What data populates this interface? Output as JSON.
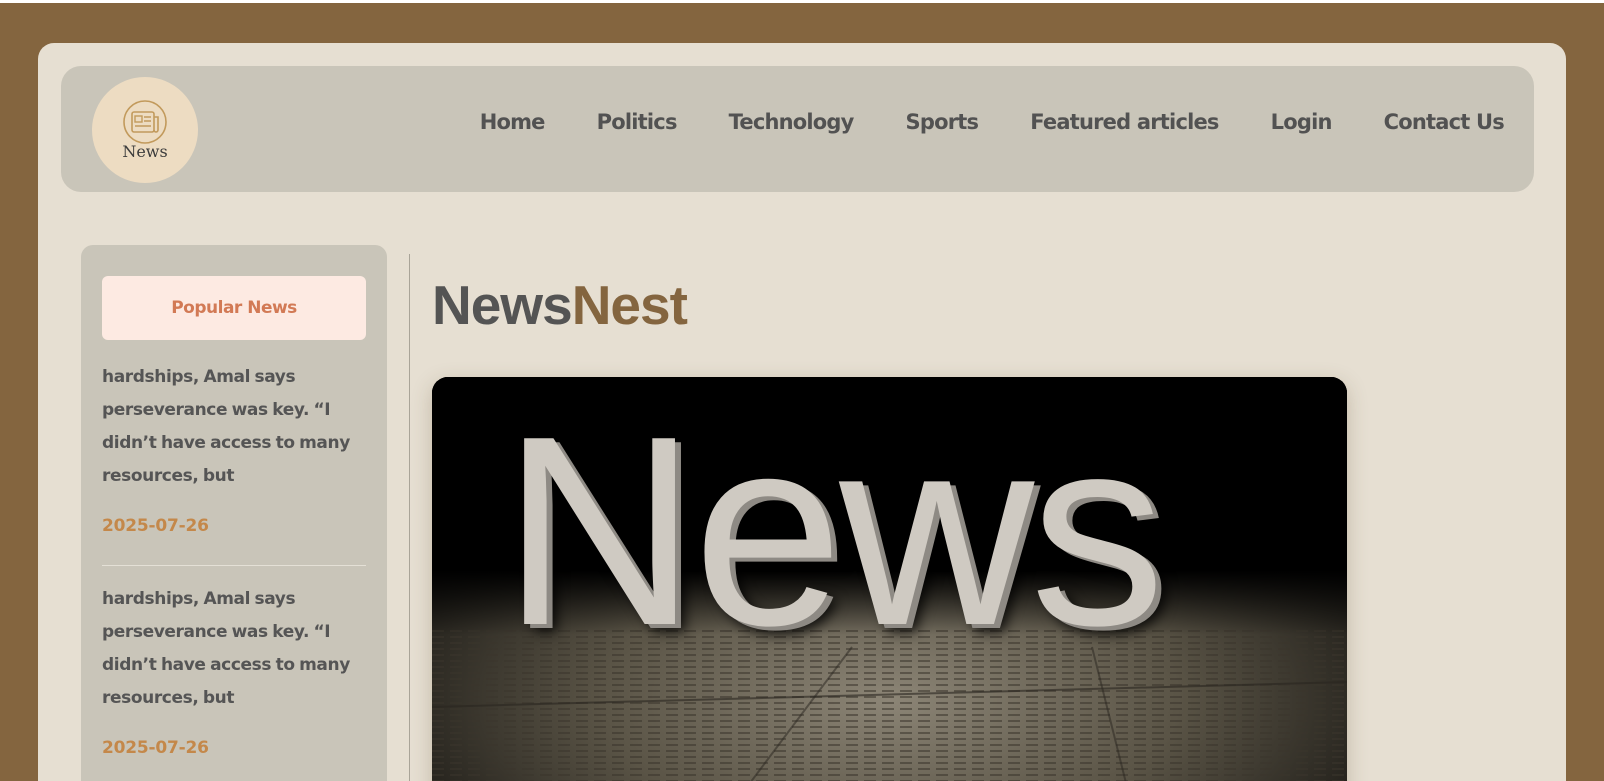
{
  "logo": {
    "icon": "newspaper-icon",
    "text": "News"
  },
  "nav": {
    "items": [
      "Home",
      "Politics",
      "Technology",
      "Sports",
      "Featured articles",
      "Login",
      "Contact Us"
    ]
  },
  "sidebar": {
    "heading": "Popular News",
    "items": [
      {
        "text": "hardships, Amal says perseverance was key. “I didn’t have access to many resources, but",
        "date": "2025-07-26"
      },
      {
        "text": "hardships, Amal says perseverance was key. “I didn’t have access to many resources, but",
        "date": "2025-07-26"
      }
    ]
  },
  "main": {
    "brand_part1": "News",
    "brand_part2": "Nest",
    "hero_word": "News"
  },
  "colors": {
    "frame": "#84653f",
    "page_bg": "#e6dfd2",
    "panel": "#c9c5b9",
    "accent": "#84653f",
    "popular_text": "#d27a55",
    "date": "#c4884a"
  }
}
